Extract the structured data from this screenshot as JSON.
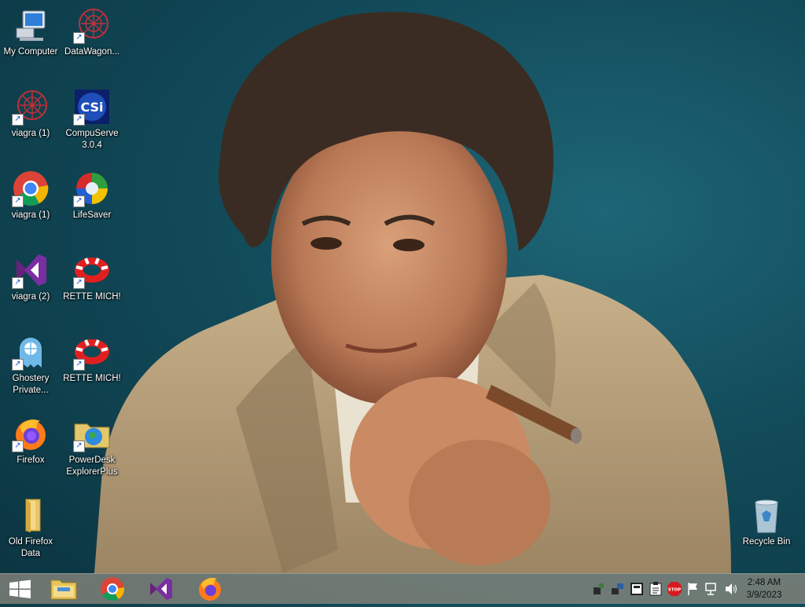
{
  "desktop": {
    "icons": [
      {
        "label": "My Computer",
        "icon": "computer-icon"
      },
      {
        "label": "DataWagon...",
        "icon": "datawagon-icon"
      },
      {
        "label": "viagra (1)",
        "icon": "red-sphere-icon"
      },
      {
        "label": "CompuServe 3.0.4",
        "icon": "compuserve-icon"
      },
      {
        "label": "viagra (1)",
        "icon": "chrome-icon"
      },
      {
        "label": "LifeSaver",
        "icon": "lifesaver-icon"
      },
      {
        "label": "viagra (2)",
        "icon": "visual-studio-icon"
      },
      {
        "label": "RETTE MICH!",
        "icon": "life-ring-icon"
      },
      {
        "label": "Ghostery Private...",
        "icon": "ghostery-icon"
      },
      {
        "label": "RETTE MICH!",
        "icon": "life-ring-icon"
      },
      {
        "label": "Firefox",
        "icon": "firefox-icon"
      },
      {
        "label": "PowerDesk ExplorerPlus",
        "icon": "powerdesk-icon"
      },
      {
        "label": "Old Firefox Data",
        "icon": "folder-icon"
      },
      {
        "label": "Recycle Bin",
        "icon": "recycle-bin-icon"
      }
    ]
  },
  "taskbar": {
    "pinned": [
      "start-icon",
      "file-explorer-icon",
      "chrome-icon",
      "visual-studio-icon",
      "firefox-icon"
    ],
    "tray": [
      "network-icon",
      "network-icon-2",
      "monitor-icon",
      "clipboard-icon",
      "stop-icon",
      "flag-icon",
      "network-status-icon",
      "volume-icon"
    ],
    "stop_label": "STOP",
    "time": "2:48 AM",
    "date": "3/9/2023"
  }
}
